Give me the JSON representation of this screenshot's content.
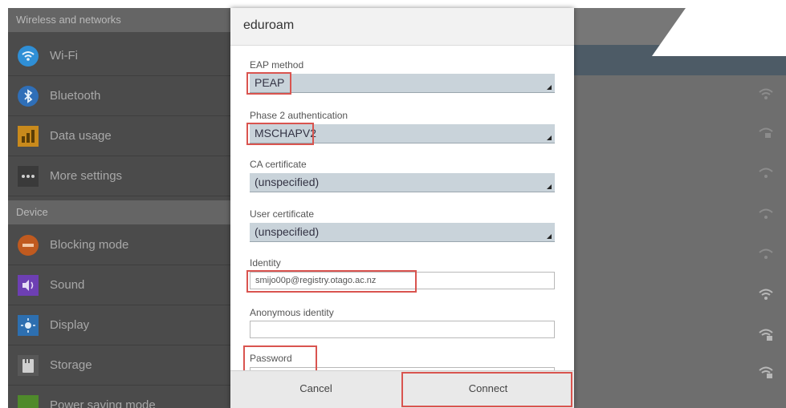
{
  "settings": {
    "sections": [
      {
        "header": "Wireless and networks"
      },
      {
        "header": "Device"
      }
    ],
    "items": [
      {
        "label": "Wi-Fi",
        "icon": "wifi-icon"
      },
      {
        "label": "Bluetooth",
        "icon": "bluetooth-icon"
      },
      {
        "label": "Data usage",
        "icon": "data-usage-icon"
      },
      {
        "label": "More settings",
        "icon": "more-settings-icon"
      },
      {
        "label": "Blocking mode",
        "icon": "blocking-mode-icon"
      },
      {
        "label": "Sound",
        "icon": "sound-icon"
      },
      {
        "label": "Display",
        "icon": "display-icon"
      },
      {
        "label": "Storage",
        "icon": "storage-icon"
      },
      {
        "label": "Power saving mode",
        "icon": "power-saving-icon"
      }
    ]
  },
  "dialog": {
    "title": "eduroam",
    "eap_method": {
      "label": "EAP method",
      "value": "PEAP"
    },
    "phase2": {
      "label": "Phase 2 authentication",
      "value": "MSCHAPV2"
    },
    "ca_certificate": {
      "label": "CA certificate",
      "value": "(unspecified)"
    },
    "user_certificate": {
      "label": "User certificate",
      "value": "(unspecified)"
    },
    "identity": {
      "label": "Identity",
      "value": "smijo00p@registry.otago.ac.nz"
    },
    "anonymous_identity": {
      "label": "Anonymous identity",
      "value": ""
    },
    "password": {
      "label": "Password"
    },
    "cancel_label": "Cancel",
    "connect_label": "Connect"
  },
  "colors": {
    "highlight": "#d9544f",
    "spinner_bg": "#c9d3da",
    "overlay_dark": "#4b4b4b"
  }
}
